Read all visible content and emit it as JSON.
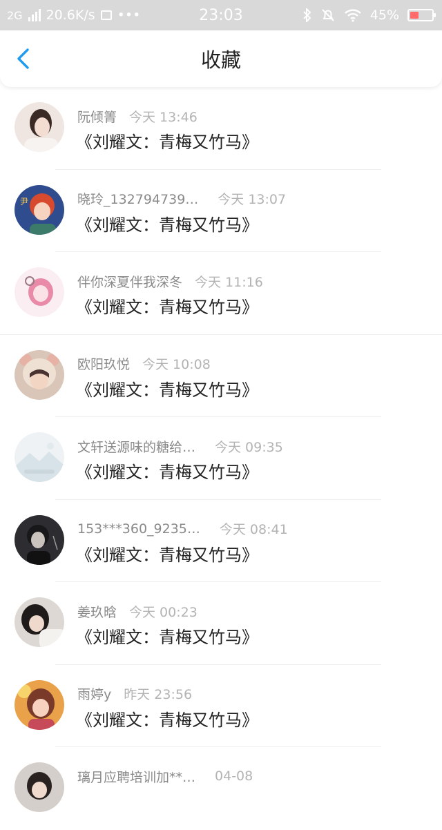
{
  "status_bar": {
    "network": "2G",
    "speed": "20.6K/s",
    "dots": "•••",
    "time": "23:03",
    "battery": "45%"
  },
  "header": {
    "title": "收藏",
    "back_icon": "chevron-left-icon",
    "accent": "#1e9bf0"
  },
  "items": [
    {
      "name": "阮倾箐",
      "time": "今天 13:46",
      "content": "《刘耀文：青梅又竹马》"
    },
    {
      "name": "晓玲_132794739…",
      "time": "今天 13:07",
      "content": "《刘耀文：青梅又竹马》"
    },
    {
      "name": "伴你深夏伴我深冬",
      "time": "今天 11:16",
      "content": "《刘耀文：青梅又竹马》"
    },
    {
      "name": "欧阳玖悦",
      "time": "今天 10:08",
      "content": "《刘耀文：青梅又竹马》"
    },
    {
      "name": "文轩送源味的糖给…",
      "time": "今天 09:35",
      "content": "《刘耀文：青梅又竹马》"
    },
    {
      "name": "153***360_9235…",
      "time": "今天 08:41",
      "content": "《刘耀文：青梅又竹马》"
    },
    {
      "name": "姜玖晗",
      "time": "今天 00:23",
      "content": "《刘耀文：青梅又竹马》"
    },
    {
      "name": "雨婷y",
      "time": "昨天 23:56",
      "content": "《刘耀文：青梅又竹马》"
    },
    {
      "name": "璃月应聘培训加**…",
      "time": "04-08",
      "content": ""
    }
  ]
}
